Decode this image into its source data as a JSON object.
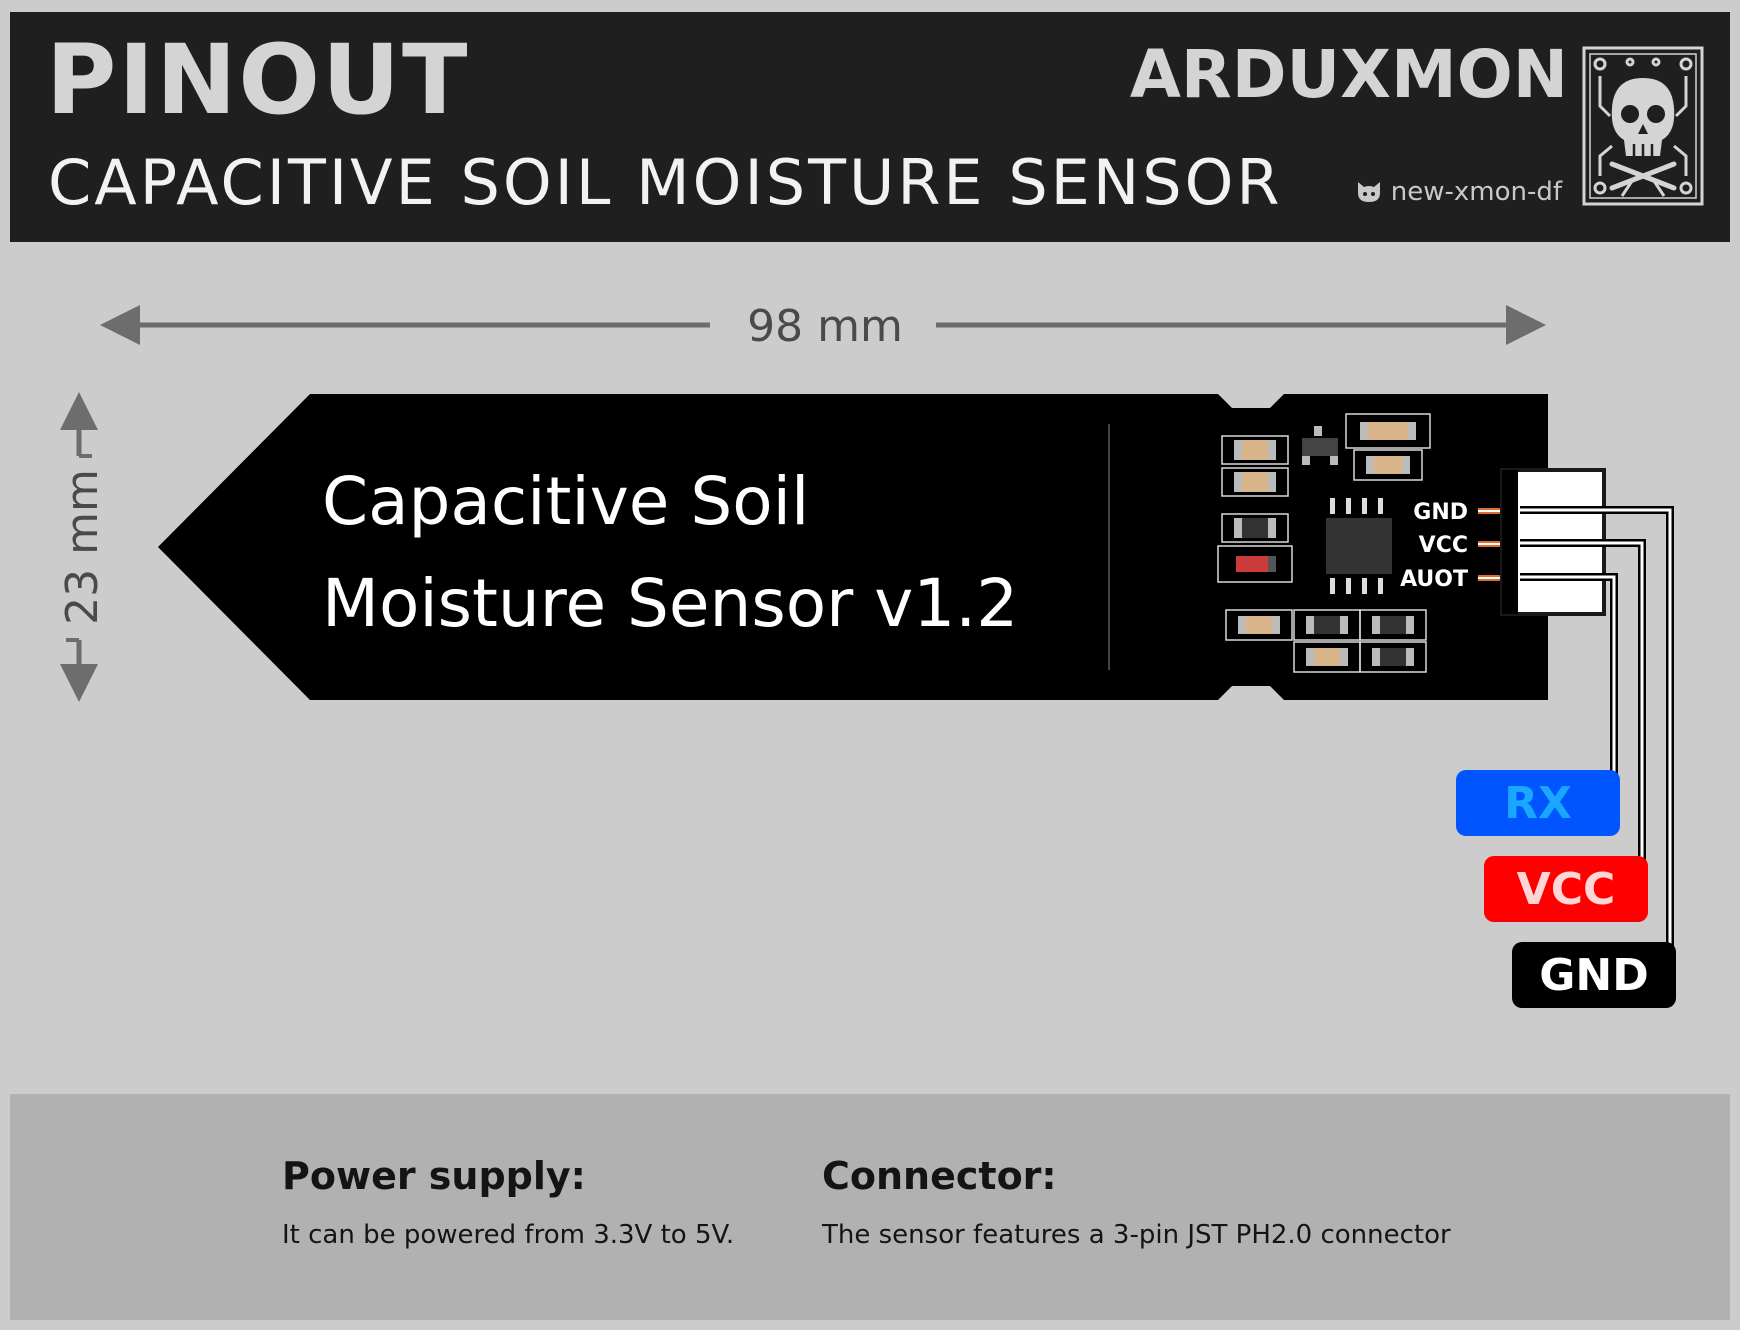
{
  "header": {
    "title": "PINOUT",
    "subtitle": "CAPACITIVE SOIL MOISTURE SENSOR",
    "brand": "ARDUXMON",
    "handle": "new-xmon-df"
  },
  "dimensions": {
    "length": "98 mm",
    "width": "23 mm"
  },
  "board": {
    "label_line1": "Capacitive Soil",
    "label_line2": "Moisture Sensor v1.2",
    "pins": [
      "GND",
      "VCC",
      "AUOT"
    ]
  },
  "wires": [
    {
      "label": "RX",
      "color": "#0055ff",
      "text_color": "#1aa7ff"
    },
    {
      "label": "VCC",
      "color": "#ff0000",
      "text_color": "#ffd6d6"
    },
    {
      "label": "GND",
      "color": "#000000",
      "text_color": "#ffffff"
    }
  ],
  "footer": {
    "power_heading": "Power supply:",
    "power_text": "It can be powered from 3.3V to 5V.",
    "connector_heading": "Connector:",
    "connector_text": "The sensor features a 3-pin JST PH2.0 connector"
  },
  "colors": {
    "background": "#cccccc",
    "header": "#1f1f1f",
    "footer": "#b1b1b1",
    "board": "#000000",
    "arrow": "#6d6d6d"
  }
}
